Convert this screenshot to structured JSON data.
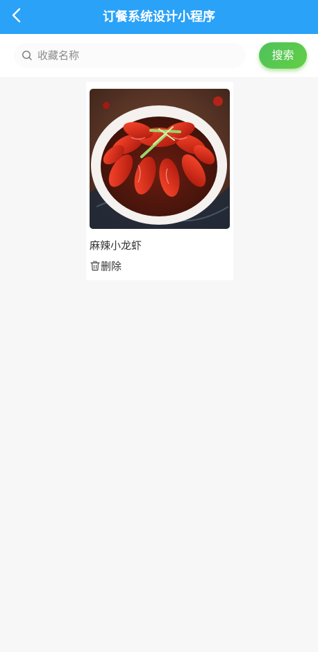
{
  "header": {
    "title": "订餐系统设计小程序",
    "back_icon": "chevron-left-icon",
    "background": "#2aa2f8"
  },
  "search": {
    "placeholder": "收藏名称",
    "value": "",
    "icon": "search-icon",
    "button_label": "搜索",
    "button_color": "#5cc94c"
  },
  "favorites": [
    {
      "name": "麻辣小龙虾",
      "image_icon": "crayfish-dish-image",
      "delete_icon": "trash-icon",
      "delete_label": "删除"
    }
  ]
}
